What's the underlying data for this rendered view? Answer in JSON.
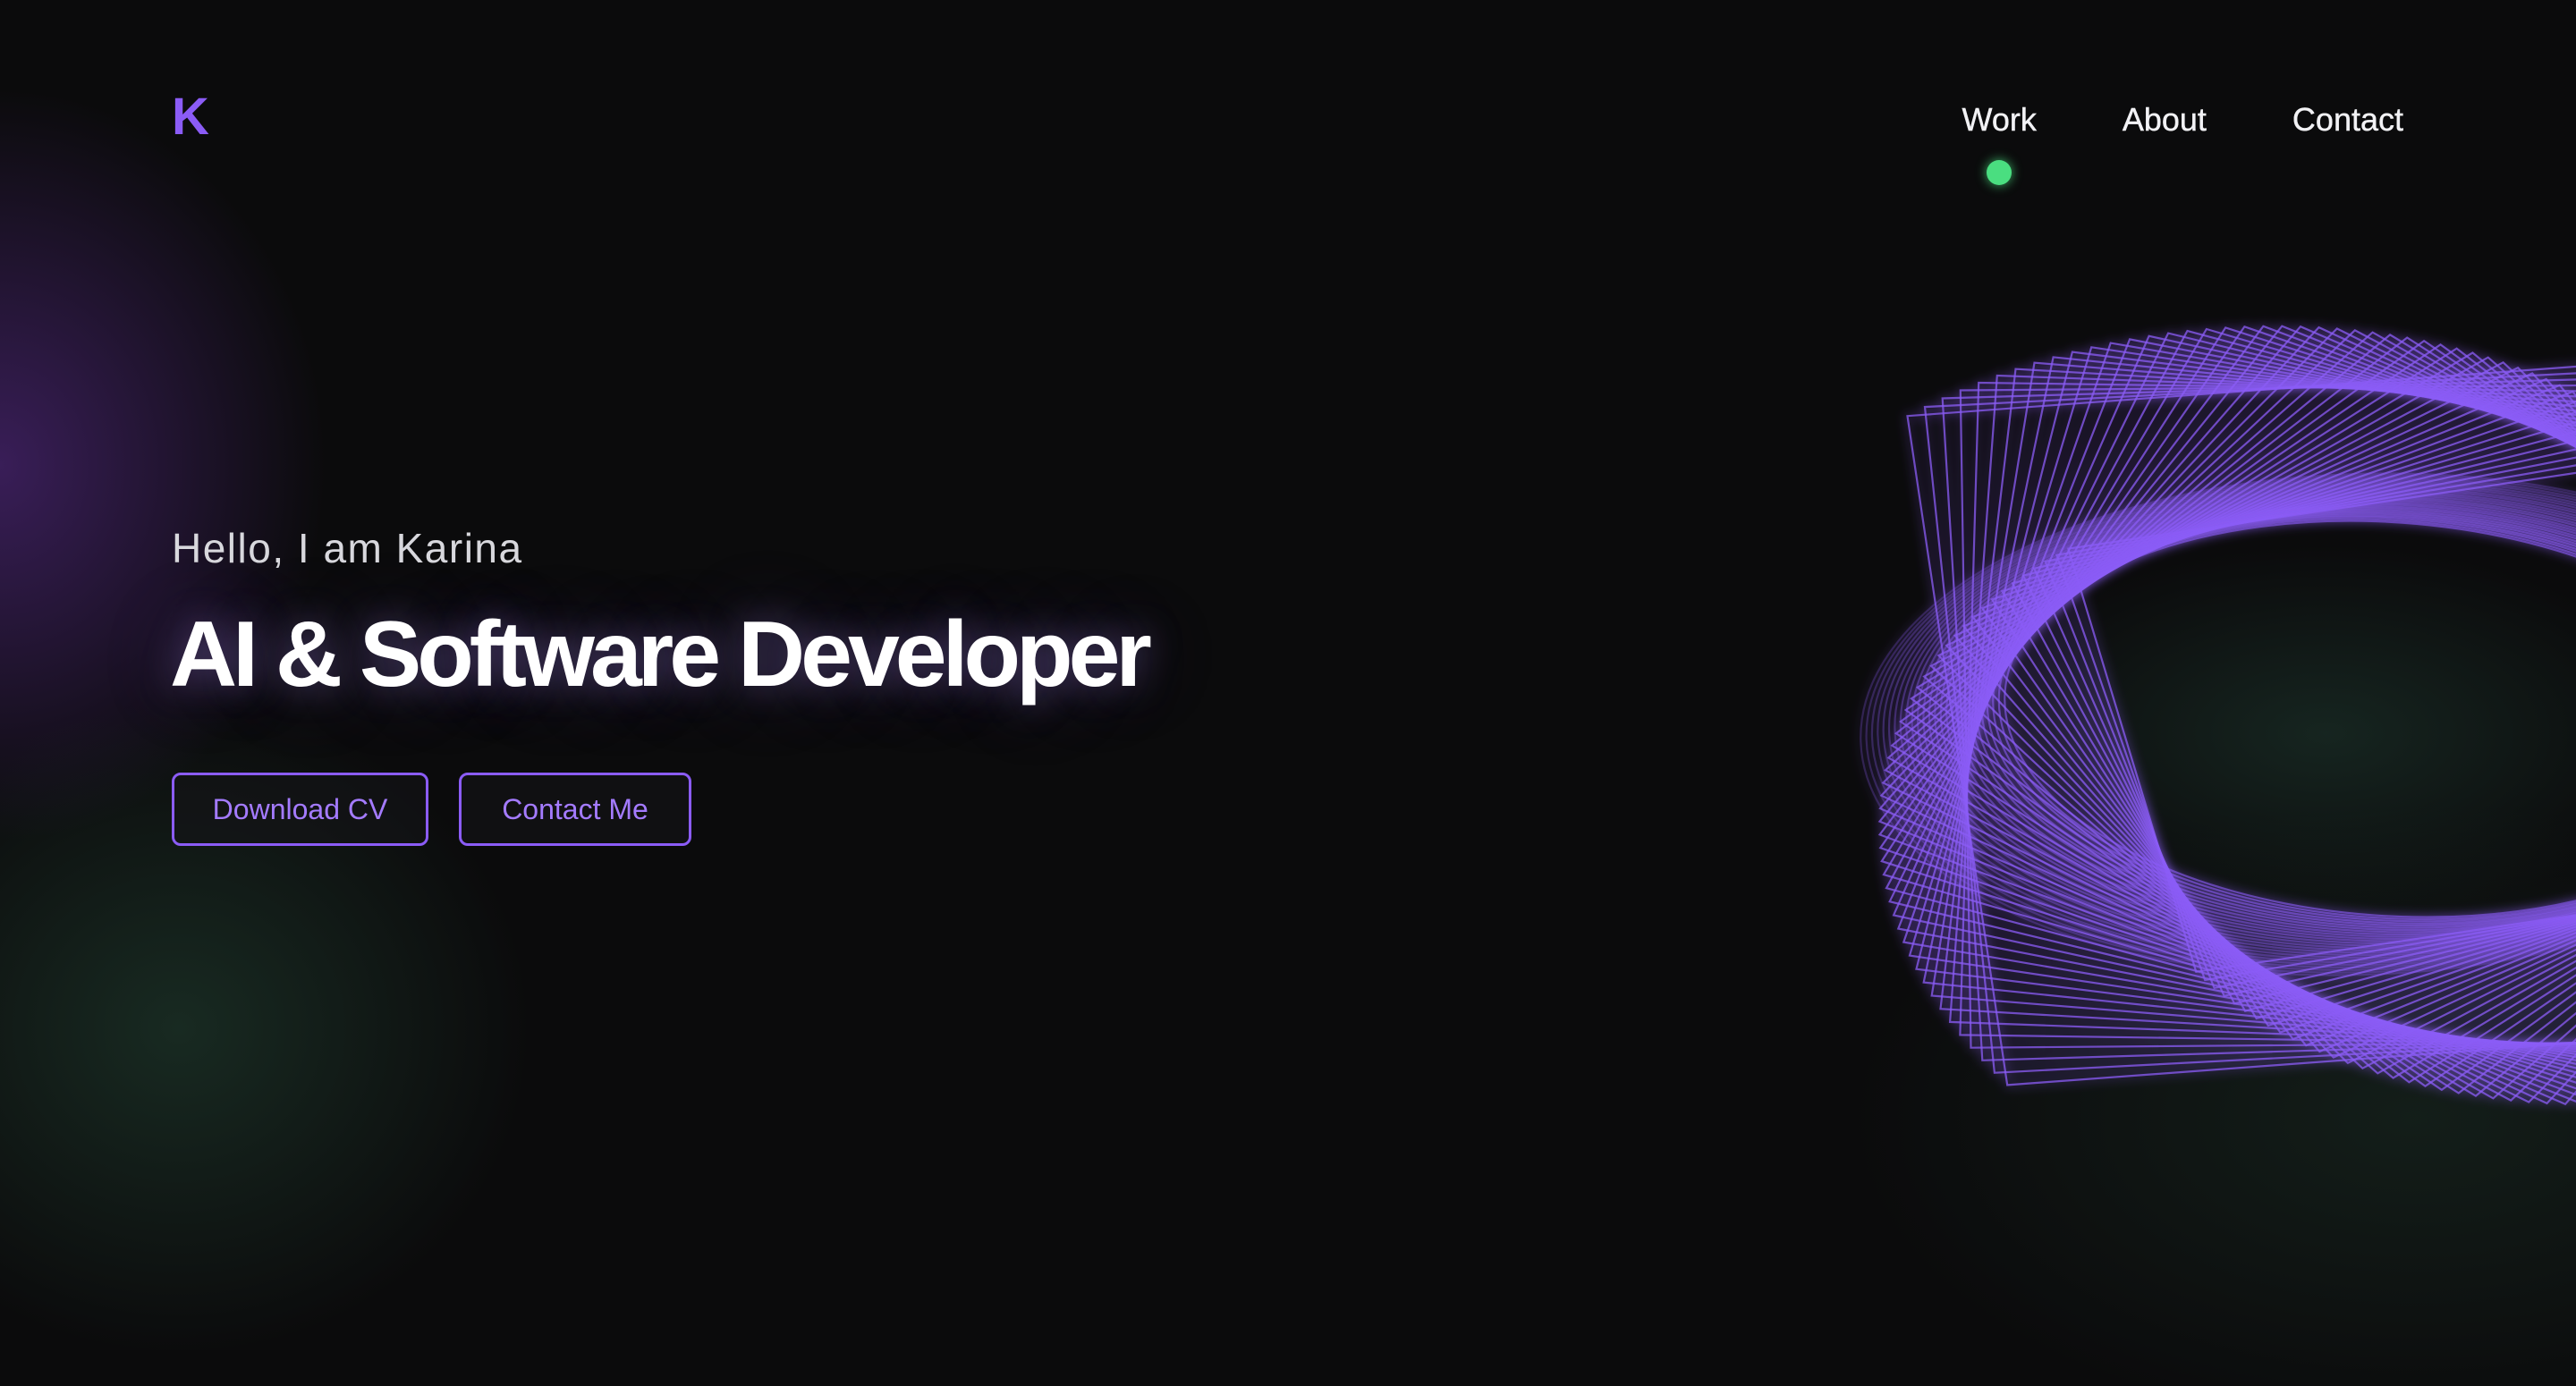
{
  "header": {
    "logo": "K",
    "nav": [
      {
        "label": "Work",
        "active": true
      },
      {
        "label": "About",
        "active": false
      },
      {
        "label": "Contact",
        "active": false
      }
    ]
  },
  "hero": {
    "greeting": "Hello, I am Karina",
    "headline": "AI & Software Developer",
    "buttons": {
      "download_label": "Download CV",
      "contact_label": "Contact Me"
    }
  },
  "colors": {
    "background": "#0b0b0c",
    "accent": "#8b5cf6",
    "active_indicator": "#4ade80",
    "text": "#ffffff"
  },
  "decoration": {
    "type": "rotating-wireframe-spiral",
    "icon": "spiral-graphic"
  }
}
